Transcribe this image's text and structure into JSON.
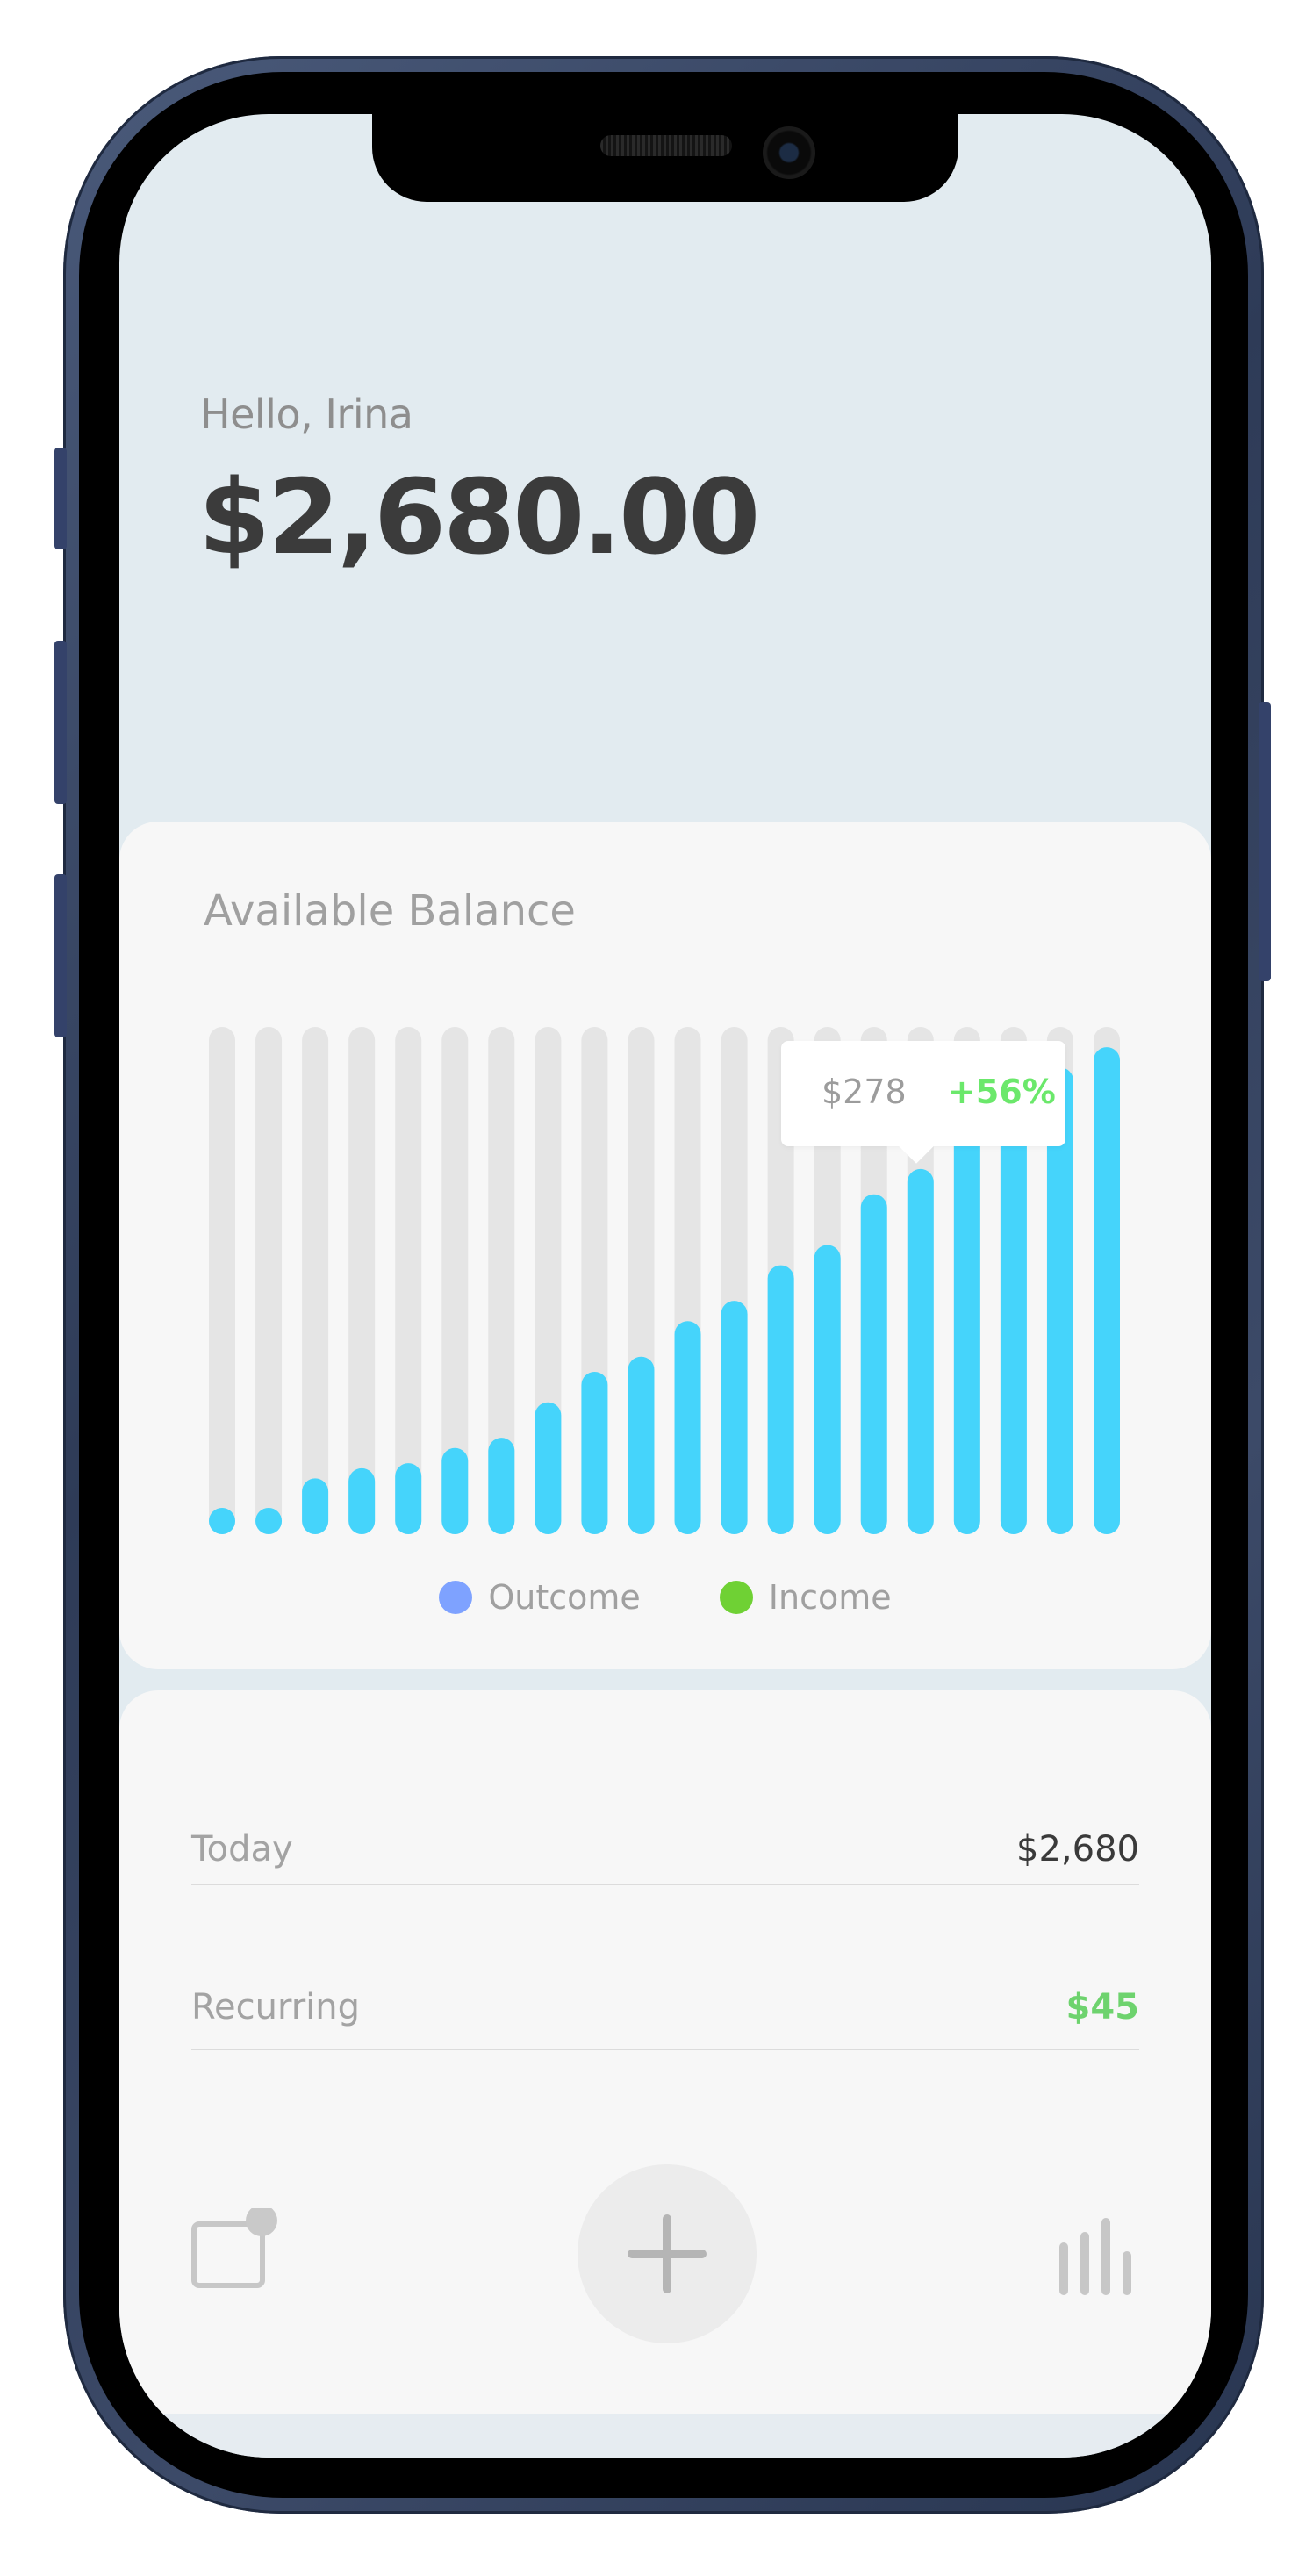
{
  "header": {
    "greeting": "Hello, Irina",
    "balance": "$2,680.00"
  },
  "chart_card": {
    "title": "Available Balance",
    "tooltip": {
      "amount": "$278",
      "change": "+56%"
    },
    "legend": [
      {
        "label": "Outcome",
        "color": "#7ea2ff"
      },
      {
        "label": "Income",
        "color": "#6fd134"
      }
    ]
  },
  "chart_data": {
    "type": "bar",
    "categories": [
      "1",
      "2",
      "3",
      "4",
      "5",
      "6",
      "7",
      "8",
      "9",
      "10",
      "11",
      "12",
      "13",
      "14",
      "15",
      "16",
      "17",
      "18",
      "19",
      "20"
    ],
    "series": [
      {
        "values": [
          0.03,
          0.05,
          0.11,
          0.13,
          0.14,
          0.17,
          0.19,
          0.26,
          0.32,
          0.35,
          0.42,
          0.46,
          0.53,
          0.57,
          0.67,
          0.72,
          0.82,
          0.86,
          0.92,
          0.96
        ]
      }
    ],
    "ylim": [
      0,
      1
    ],
    "bar_color": "#45d4fb",
    "track_color": "#e5e5e5"
  },
  "list": {
    "rows": [
      {
        "label": "Today",
        "value": "$2,680"
      },
      {
        "label": "Recurring",
        "value": "$45"
      }
    ]
  },
  "tab_bar": {
    "icons": [
      "wallet-icon",
      "plus-icon",
      "stats-icon"
    ]
  }
}
